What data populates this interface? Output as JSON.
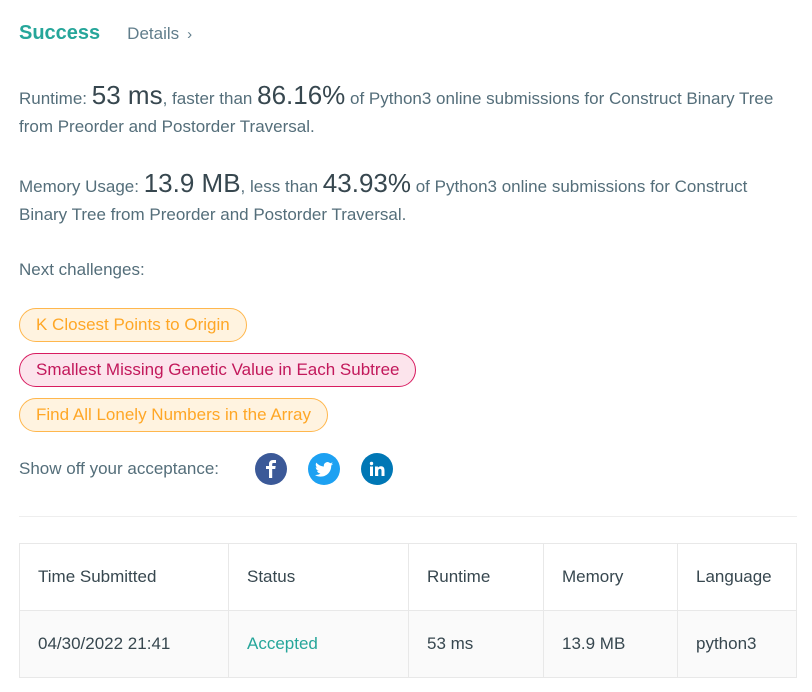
{
  "header": {
    "status": "Success",
    "details_label": "Details",
    "details_chevron": "›"
  },
  "runtime": {
    "label": "Runtime:",
    "value": "53 ms",
    "comparison": "faster than",
    "percent": "86.16%",
    "suffix": "of Python3 online submissions for Construct Binary Tree from Preorder and Postorder Traversal."
  },
  "memory": {
    "label": "Memory Usage:",
    "value": "13.9 MB",
    "comparison": "less than",
    "percent": "43.93%",
    "suffix": "of Python3 online submissions for Construct Binary Tree from Preorder and Postorder Traversal."
  },
  "next": {
    "label": "Next challenges:",
    "challenges": [
      {
        "title": "K Closest Points to Origin",
        "difficulty": "medium"
      },
      {
        "title": "Smallest Missing Genetic Value in Each Subtree",
        "difficulty": "hard"
      },
      {
        "title": "Find All Lonely Numbers in the Array",
        "difficulty": "medium"
      }
    ]
  },
  "share": {
    "label": "Show off your acceptance:",
    "icons": [
      "facebook-icon",
      "twitter-icon",
      "linkedin-icon"
    ]
  },
  "table": {
    "headers": [
      "Time Submitted",
      "Status",
      "Runtime",
      "Memory",
      "Language"
    ],
    "rows": [
      [
        "04/30/2022 21:41",
        "Accepted",
        "53 ms",
        "13.9 MB",
        "python3"
      ]
    ]
  },
  "colors": {
    "success": "#26a69a",
    "medium": "#ffa726",
    "hard": "#c2185b",
    "facebook": "#3b5998",
    "twitter": "#1da1f2",
    "linkedin": "#0077b5"
  }
}
